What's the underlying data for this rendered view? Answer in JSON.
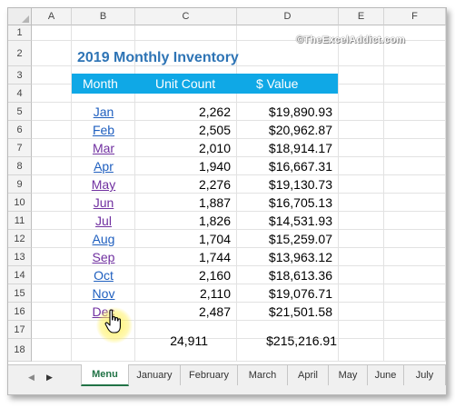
{
  "spreadsheet": {
    "columns": [
      "A",
      "B",
      "C",
      "D",
      "E",
      "F"
    ],
    "rows": [
      "1",
      "2",
      "3",
      "4",
      "5",
      "6",
      "7",
      "8",
      "9",
      "10",
      "11",
      "12",
      "13",
      "14",
      "15",
      "16",
      "17",
      "18"
    ],
    "title": "2019 Monthly Inventory",
    "watermark": "©TheExcelAddict.com",
    "headers": {
      "month": "Month",
      "unit_count": "Unit Count",
      "value": "$ Value"
    },
    "data_rows": [
      {
        "month": "Jan",
        "units": "2,262",
        "value": "$19,890.93",
        "visited": false
      },
      {
        "month": "Feb",
        "units": "2,505",
        "value": "$20,962.87",
        "visited": false
      },
      {
        "month": "Mar",
        "units": "2,010",
        "value": "$18,914.17",
        "visited": true
      },
      {
        "month": "Apr",
        "units": "1,940",
        "value": "$16,667.31",
        "visited": false
      },
      {
        "month": "May",
        "units": "2,276",
        "value": "$19,130.73",
        "visited": true
      },
      {
        "month": "Jun",
        "units": "1,887",
        "value": "$16,705.13",
        "visited": true
      },
      {
        "month": "Jul",
        "units": "1,826",
        "value": "$14,531.93",
        "visited": true
      },
      {
        "month": "Aug",
        "units": "1,704",
        "value": "$15,259.07",
        "visited": false
      },
      {
        "month": "Sep",
        "units": "1,744",
        "value": "$13,963.12",
        "visited": true
      },
      {
        "month": "Oct",
        "units": "2,160",
        "value": "$18,613.36",
        "visited": false
      },
      {
        "month": "Nov",
        "units": "2,110",
        "value": "$19,076.71",
        "visited": false
      },
      {
        "month": "Dec",
        "units": "2,487",
        "value": "$21,501.58",
        "visited": true
      }
    ],
    "totals": {
      "units": "24,911",
      "value": "$215,216.91"
    }
  },
  "sheet_tabs": [
    "Menu",
    "January",
    "February",
    "March",
    "April",
    "May",
    "June",
    "July"
  ],
  "active_tab": "Menu",
  "colors": {
    "header_band": "#0fa8e6",
    "title": "#2e74b5",
    "link": "#1f5fbf",
    "visited": "#7030a0",
    "active_tab": "#217346"
  },
  "icons": {
    "cursor": "hand-pointer-icon",
    "tab_scroll_left": "triangle-left-icon",
    "tab_scroll_right": "triangle-right-icon"
  }
}
